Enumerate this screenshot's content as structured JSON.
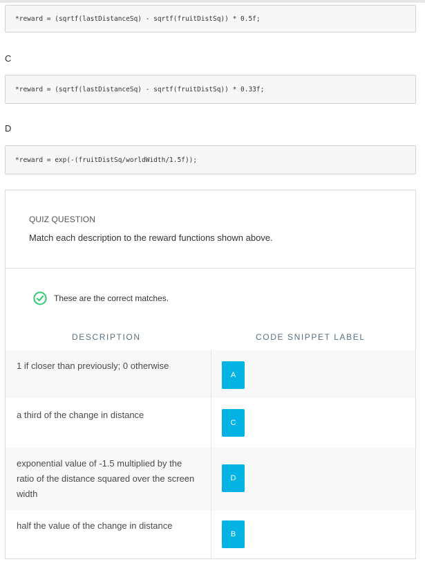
{
  "code_snippets": [
    {
      "letter": "",
      "code": "*reward = (sqrtf(lastDistanceSq) - sqrtf(fruitDistSq)) * 0.5f;"
    },
    {
      "letter": "C",
      "code": "*reward = (sqrtf(lastDistanceSq) - sqrtf(fruitDistSq)) * 0.33f;"
    },
    {
      "letter": "D",
      "code": "*reward = exp(-(fruitDistSq/worldWidth/1.5f));"
    }
  ],
  "quiz": {
    "label": "QUIZ QUESTION",
    "prompt": "Match each description to the reward functions shown above.",
    "result_text": "These are the correct matches.",
    "columns": {
      "description": "DESCRIPTION",
      "code_label": "CODE SNIPPET LABEL"
    },
    "rows": [
      {
        "description": "1 if closer than previously; 0 otherwise",
        "label": "A"
      },
      {
        "description": "a third of the change in distance",
        "label": "C"
      },
      {
        "description": "exponential value of -1.5 multiplied by the ratio of the distance squared over the screen width",
        "label": "D"
      },
      {
        "description": "half the value of the change in distance",
        "label": "B"
      }
    ]
  },
  "colors": {
    "accent": "#02b3e4",
    "success": "#2ecc71"
  },
  "icons": {
    "result": "check-circle-icon"
  }
}
